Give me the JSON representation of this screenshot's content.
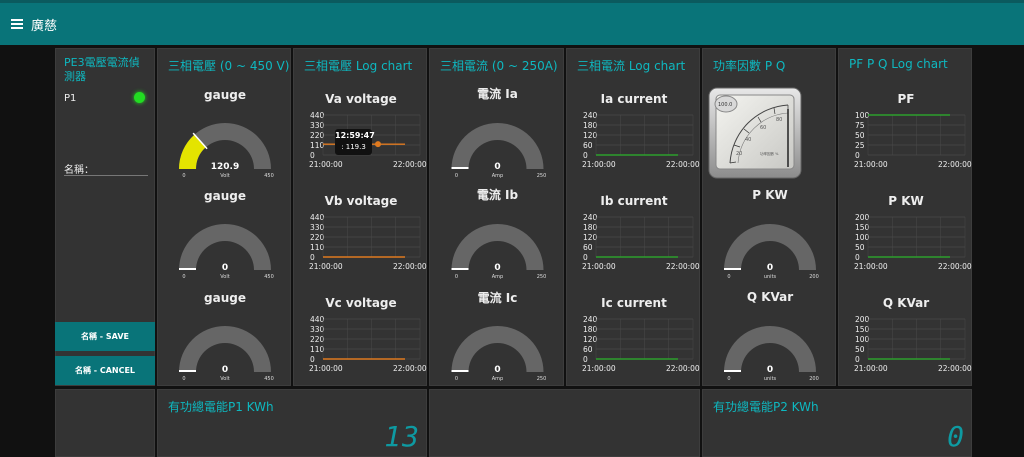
{
  "app": {
    "title": "廣慈"
  },
  "control": {
    "title": "PE3電壓電流偵測器",
    "status_label": "P1",
    "status_color": "#22dd22",
    "name_label": "名稱：",
    "name_value": "",
    "save_label": "名稱 - SAVE",
    "cancel_label": "名稱 - CANCEL"
  },
  "voltage_gauges": {
    "title": "三相電壓 (0 ~ 450 V)",
    "gauges": [
      {
        "label": "gauge",
        "value": "120.9",
        "fill": 0.269,
        "min": "0",
        "max": "450",
        "unit": "Volt",
        "color": "#e4e400"
      },
      {
        "label": "gauge",
        "value": "0",
        "fill": 0,
        "min": "0",
        "max": "450",
        "unit": "Volt",
        "color": "#ffffff"
      },
      {
        "label": "gauge",
        "value": "0",
        "fill": 0,
        "min": "0",
        "max": "450",
        "unit": "Volt",
        "color": "#ffffff"
      }
    ]
  },
  "voltage_logs": {
    "title": "三相電壓 Log chart",
    "charts": [
      {
        "label": "Va voltage",
        "ticks": [
          "440",
          "330",
          "220",
          "110",
          "0"
        ],
        "x_start": "21:00:00",
        "x_end": "22:00:00",
        "line_value": 119.3,
        "line_color": "#e07a1f",
        "ymax": 440
      },
      {
        "label": "Vb voltage",
        "ticks": [
          "440",
          "330",
          "220",
          "110",
          "0"
        ],
        "x_start": "21:00:00",
        "x_end": "22:00:00",
        "line_value": 0,
        "line_color": "#e07a1f",
        "ymax": 440
      },
      {
        "label": "Vc voltage",
        "ticks": [
          "440",
          "330",
          "220",
          "110",
          "0"
        ],
        "x_start": "21:00:00",
        "x_end": "22:00:00",
        "line_value": 0,
        "line_color": "#e07a1f",
        "ymax": 440
      }
    ],
    "tooltip": {
      "time": "12:59:47",
      "value": ": 119.3"
    }
  },
  "current_gauges": {
    "title": "三相電流 (0 ~ 250A)",
    "gauges": [
      {
        "label": "電流 Ia",
        "value": "0",
        "fill": 0,
        "min": "0",
        "max": "250",
        "unit": "Amp",
        "color": "#ffffff"
      },
      {
        "label": "電流 Ib",
        "value": "0",
        "fill": 0,
        "min": "0",
        "max": "250",
        "unit": "Amp",
        "color": "#ffffff"
      },
      {
        "label": "電流 Ic",
        "value": "0",
        "fill": 0,
        "min": "0",
        "max": "250",
        "unit": "Amp",
        "color": "#ffffff"
      }
    ]
  },
  "current_logs": {
    "title": "三相電流 Log chart",
    "charts": [
      {
        "label": "Ia current",
        "ticks": [
          "240",
          "180",
          "120",
          "60",
          "0"
        ],
        "x_start": "21:00:00",
        "x_end": "22:00:00",
        "line_value": 0,
        "line_color": "#2ca02c",
        "ymax": 240
      },
      {
        "label": "Ib current",
        "ticks": [
          "240",
          "180",
          "120",
          "60",
          "0"
        ],
        "x_start": "21:00:00",
        "x_end": "22:00:00",
        "line_value": 0,
        "line_color": "#2ca02c",
        "ymax": 240
      },
      {
        "label": "Ic current",
        "ticks": [
          "240",
          "180",
          "120",
          "60",
          "0"
        ],
        "x_start": "21:00:00",
        "x_end": "22:00:00",
        "line_value": 0,
        "line_color": "#2ca02c",
        "ymax": 240
      }
    ]
  },
  "power_gauges": {
    "title": "功率因數 P Q",
    "meter_label": "100.0",
    "gauges": [
      {
        "label": "P KW",
        "value": "0",
        "fill": 0,
        "min": "0",
        "max": "200",
        "unit": "units",
        "color": "#ffffff"
      },
      {
        "label": "Q KVar",
        "value": "0",
        "fill": 0,
        "min": "0",
        "max": "200",
        "unit": "units",
        "color": "#ffffff"
      }
    ]
  },
  "power_logs": {
    "title": "PF P Q Log chart",
    "charts": [
      {
        "label": "PF",
        "ticks": [
          "100",
          "75",
          "50",
          "25",
          "0"
        ],
        "x_start": "21:00:00",
        "x_end": "22:00:00",
        "line_value": 100,
        "line_color": "#2ca02c",
        "ymax": 100
      },
      {
        "label": "P KW",
        "ticks": [
          "200",
          "150",
          "100",
          "50",
          "0"
        ],
        "x_start": "21:00:00",
        "x_end": "22:00:00",
        "line_value": 0,
        "line_color": "#2ca02c",
        "ymax": 200
      },
      {
        "label": "Q KVar",
        "ticks": [
          "200",
          "150",
          "100",
          "50",
          "0"
        ],
        "x_start": "21:00:00",
        "x_end": "22:00:00",
        "line_value": 0,
        "line_color": "#2ca02c",
        "ymax": 200
      }
    ]
  },
  "energy": {
    "p1_title": "有功總電能P1 KWh",
    "p1_value": "13",
    "p2_title": "有功總電能P2 KWh",
    "p2_value": "0",
    "digit_color": "#0e9aa2"
  }
}
